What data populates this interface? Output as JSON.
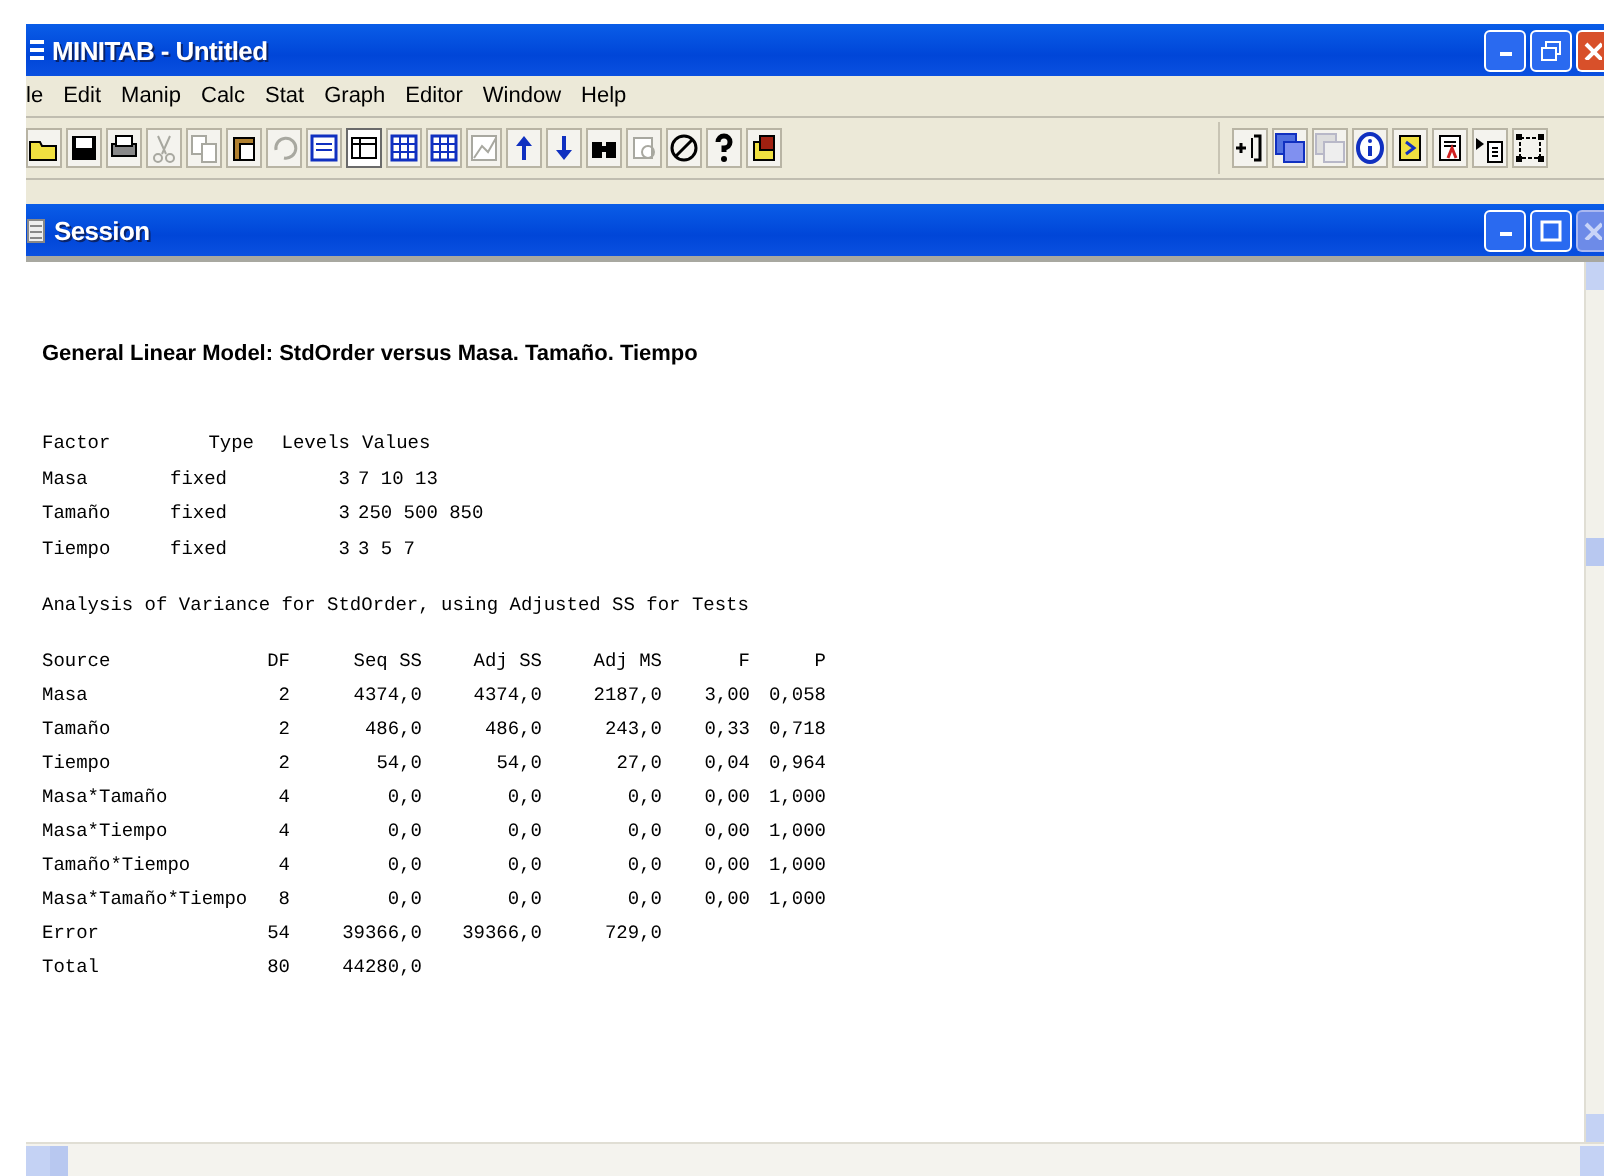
{
  "window": {
    "title": "MINITAB - Untitled"
  },
  "menu": [
    "le",
    "Edit",
    "Manip",
    "Calc",
    "Stat",
    "Graph",
    "Editor",
    "Window",
    "Help"
  ],
  "toolbar_left": [
    {
      "kind": "open",
      "disabled": false
    },
    {
      "kind": "save",
      "disabled": false
    },
    {
      "kind": "print",
      "disabled": false
    },
    {
      "kind": "cut",
      "disabled": true
    },
    {
      "kind": "copy",
      "disabled": true
    },
    {
      "kind": "paste",
      "disabled": false
    },
    {
      "kind": "undo",
      "disabled": true
    },
    {
      "kind": "session",
      "disabled": false
    },
    {
      "kind": "worksheet",
      "disabled": false,
      "pressed": true
    },
    {
      "kind": "grid",
      "disabled": false
    },
    {
      "kind": "grid",
      "disabled": false
    },
    {
      "kind": "graph",
      "disabled": true
    },
    {
      "kind": "up",
      "disabled": false
    },
    {
      "kind": "down",
      "disabled": false
    },
    {
      "kind": "find",
      "disabled": false
    },
    {
      "kind": "replace",
      "disabled": true
    },
    {
      "kind": "cancel",
      "disabled": false
    },
    {
      "kind": "help",
      "disabled": false
    },
    {
      "kind": "exit",
      "disabled": false
    }
  ],
  "toolbar_right": [
    {
      "kind": "bracket",
      "disabled": false
    },
    {
      "kind": "windows",
      "disabled": false
    },
    {
      "kind": "windows",
      "disabled": true
    },
    {
      "kind": "info",
      "disabled": false
    },
    {
      "kind": "note",
      "disabled": false
    },
    {
      "kind": "report",
      "disabled": false
    },
    {
      "kind": "insert",
      "disabled": false
    },
    {
      "kind": "frame",
      "disabled": false
    }
  ],
  "session": {
    "title": "Session",
    "heading": "General Linear Model: StdOrder versus Masa. Tamaño. Tiempo",
    "factors": {
      "columns": [
        "Factor",
        "Type",
        "Levels",
        "Values"
      ],
      "rows": [
        [
          "Masa",
          "fixed",
          "3",
          "7 10 13"
        ],
        [
          "Tamaño",
          "fixed",
          "3",
          "250 500 850"
        ],
        [
          "Tiempo",
          "fixed",
          "3",
          "3 5 7"
        ]
      ]
    },
    "anova_title": "Analysis of Variance for StdOrder, using Adjusted SS for Tests",
    "anova": {
      "columns": [
        "Source",
        "DF",
        "Seq SS",
        "Adj SS",
        "Adj MS",
        "F",
        "P"
      ],
      "rows": [
        [
          "Masa",
          "2",
          "4374,0",
          "4374,0",
          "2187,0",
          "3,00",
          "0,058"
        ],
        [
          "Tamaño",
          "2",
          "486,0",
          "486,0",
          "243,0",
          "0,33",
          "0,718"
        ],
        [
          "Tiempo",
          "2",
          "54,0",
          "54,0",
          "27,0",
          "0,04",
          "0,964"
        ],
        [
          "Masa*Tamaño",
          "4",
          "0,0",
          "0,0",
          "0,0",
          "0,00",
          "1,000"
        ],
        [
          "Masa*Tiempo",
          "4",
          "0,0",
          "0,0",
          "0,0",
          "0,00",
          "1,000"
        ],
        [
          "Tamaño*Tiempo",
          "4",
          "0,0",
          "0,0",
          "0,0",
          "0,00",
          "1,000"
        ],
        [
          "Masa*Tamaño*Tiempo",
          "8",
          "0,0",
          "0,0",
          "0,0",
          "0,00",
          "1,000"
        ],
        [
          "Error",
          "54",
          "39366,0",
          "39366,0",
          "729,0",
          "",
          ""
        ],
        [
          "Total",
          "80",
          "44280,0",
          "",
          "",
          "",
          ""
        ]
      ]
    }
  }
}
